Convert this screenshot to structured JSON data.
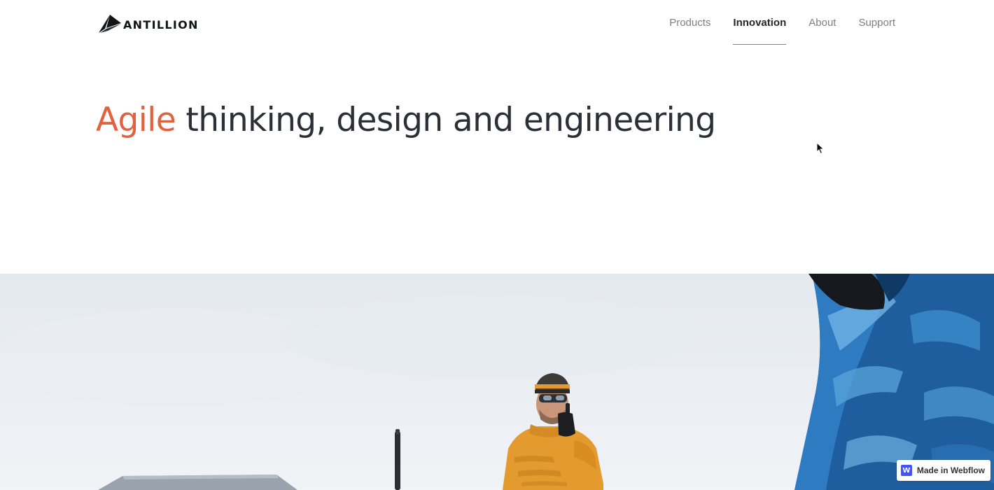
{
  "header": {
    "logo_text": "ANTILLION",
    "logo_icon": "antillion-peak-icon",
    "nav": [
      {
        "label": "Products",
        "active": false
      },
      {
        "label": "Innovation",
        "active": true
      },
      {
        "label": "About",
        "active": false
      },
      {
        "label": "Support",
        "active": false
      }
    ]
  },
  "hero": {
    "title_accent": "Agile",
    "title_rest": " thinking, design and engineering"
  },
  "photo": {
    "description_icon": "hero-photo"
  },
  "badge": {
    "icon_letter": "W",
    "label": "Made in Webflow"
  },
  "colors": {
    "accent": "#e0623f",
    "text_dark": "#2b2f36",
    "nav_inactive": "#7a7f86",
    "webflow_blue": "#4353ff"
  }
}
